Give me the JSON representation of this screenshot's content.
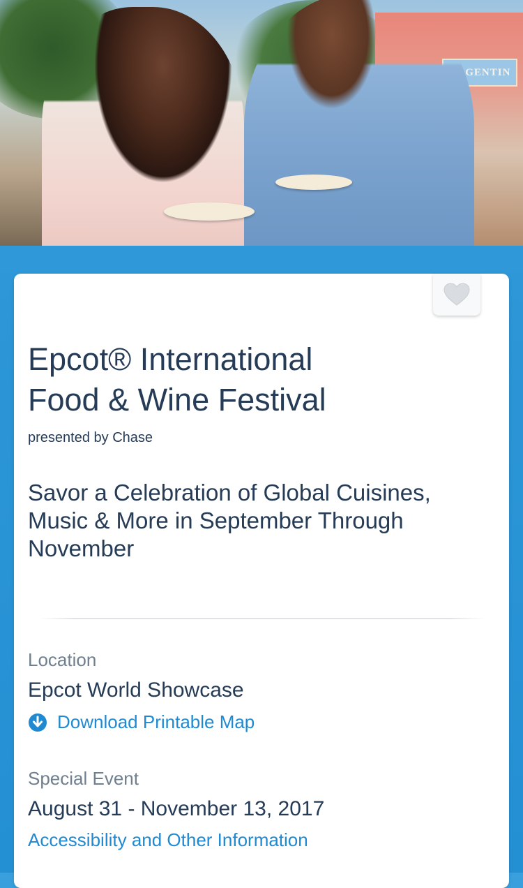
{
  "hero": {
    "sign_text": "ARGENTIN"
  },
  "event": {
    "title_line1": "Epcot® International",
    "title_line2": "Food & Wine Festival",
    "presenter": "presented by Chase",
    "tagline": "Savor a Celebration of Global Cuisines, Music & More in September Through November"
  },
  "location": {
    "label": "Location",
    "value": "Epcot World Showcase",
    "map_link": "Download Printable Map"
  },
  "special_event": {
    "label": "Special Event",
    "dates": "August 31 - November 13, 2017",
    "info_link": "Accessibility and Other Information"
  },
  "colors": {
    "background_blue": "#2b95d6",
    "text_navy": "#253b56",
    "link_blue": "#1f8ad1",
    "label_gray": "#6f7f8f"
  },
  "icons": {
    "favorite": "heart-icon",
    "download": "download-circle-icon"
  }
}
